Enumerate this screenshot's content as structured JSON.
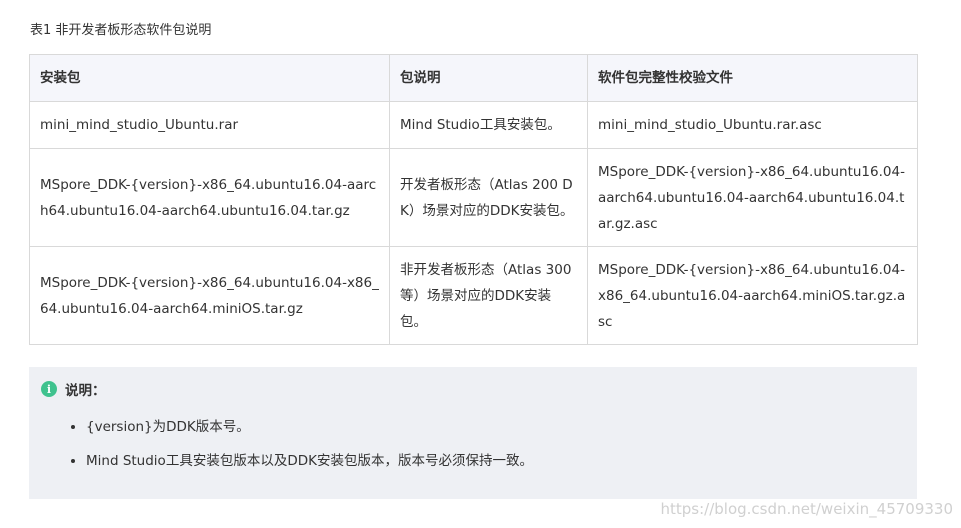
{
  "caption": "表1 非开发者板形态软件包说明",
  "table": {
    "headers": [
      "安装包",
      "包说明",
      "软件包完整性校验文件"
    ],
    "rows": [
      {
        "package": "mini_mind_studio_Ubuntu.rar",
        "description": "Mind Studio工具安装包。",
        "checksum_file": "mini_mind_studio_Ubuntu.rar.asc"
      },
      {
        "package": "MSpore_DDK-{version}-x86_64.ubuntu16.04-aarch64.ubuntu16.04-aarch64.ubuntu16.04.tar.gz",
        "description": "开发者板形态（Atlas 200 DK）场景对应的DDK安装包。",
        "checksum_file": "MSpore_DDK-{version}-x86_64.ubuntu16.04-aarch64.ubuntu16.04-aarch64.ubuntu16.04.tar.gz.asc"
      },
      {
        "package": "MSpore_DDK-{version}-x86_64.ubuntu16.04-x86_64.ubuntu16.04-aarch64.miniOS.tar.gz",
        "description": "非开发者板形态（Atlas 300等）场景对应的DDK安装包。",
        "checksum_file": "MSpore_DDK-{version}-x86_64.ubuntu16.04-x86_64.ubuntu16.04-aarch64.miniOS.tar.gz.asc"
      }
    ]
  },
  "note": {
    "icon": "info-icon",
    "icon_color": "#3fc28e",
    "title": "说明：",
    "items": [
      "{version}为DDK版本号。",
      "Mind Studio工具安装包版本以及DDK安装包版本，版本号必须保持一致。"
    ]
  },
  "watermark": "https://blog.csdn.net/weixin_45709330"
}
